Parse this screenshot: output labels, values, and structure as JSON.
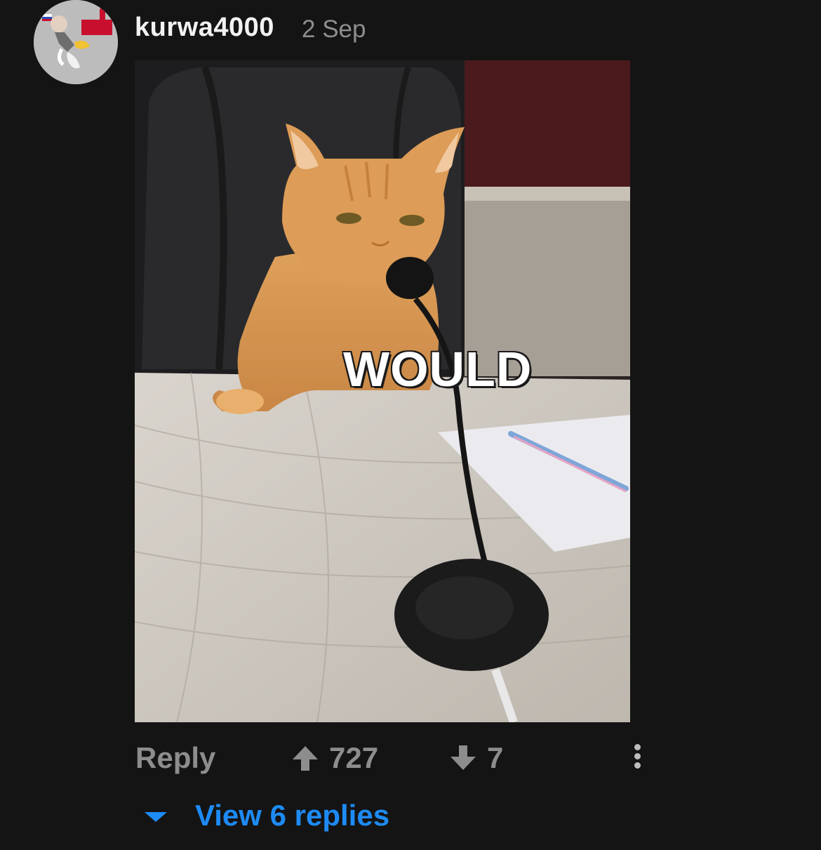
{
  "comment": {
    "username": "kurwa4000",
    "timestamp": "2 Sep",
    "avatar_icon": "user-avatar-icon",
    "media": {
      "caption": "WOULD",
      "icon": "cat-microphone-meme-image"
    },
    "actions": {
      "reply_label": "Reply",
      "upvote_count": "727",
      "downvote_count": "7",
      "upvote_icon": "arrow-up-icon",
      "downvote_icon": "arrow-down-icon",
      "more_icon": "more-vertical-icon"
    },
    "replies": {
      "label": "View 6 replies",
      "icon": "caret-down-icon"
    },
    "colors": {
      "background": "#141414",
      "username": "#f2f2f2",
      "muted": "#8d8d8d",
      "link": "#1e8bf5"
    }
  }
}
